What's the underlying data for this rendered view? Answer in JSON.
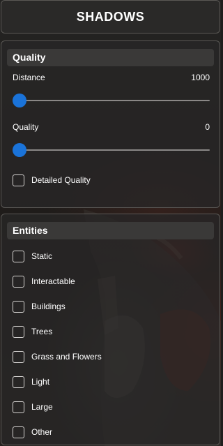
{
  "header": {
    "title": "SHADOWS"
  },
  "quality": {
    "title": "Quality",
    "sliders": [
      {
        "label": "Distance",
        "value": "1000",
        "fraction": 0.0
      },
      {
        "label": "Quality",
        "value": "0",
        "fraction": 0.0
      }
    ],
    "detailed_quality": {
      "label": "Detailed Quality",
      "checked": false
    }
  },
  "entities": {
    "title": "Entities",
    "items": [
      {
        "label": "Static",
        "checked": false
      },
      {
        "label": "Interactable",
        "checked": false
      },
      {
        "label": "Buildings",
        "checked": false
      },
      {
        "label": "Trees",
        "checked": false
      },
      {
        "label": "Grass and Flowers",
        "checked": false
      },
      {
        "label": "Light",
        "checked": false
      },
      {
        "label": "Large",
        "checked": false
      },
      {
        "label": "Other",
        "checked": false
      }
    ]
  },
  "colors": {
    "accent": "#1a73d9",
    "panel": "#282726",
    "border": "#5a5855"
  }
}
